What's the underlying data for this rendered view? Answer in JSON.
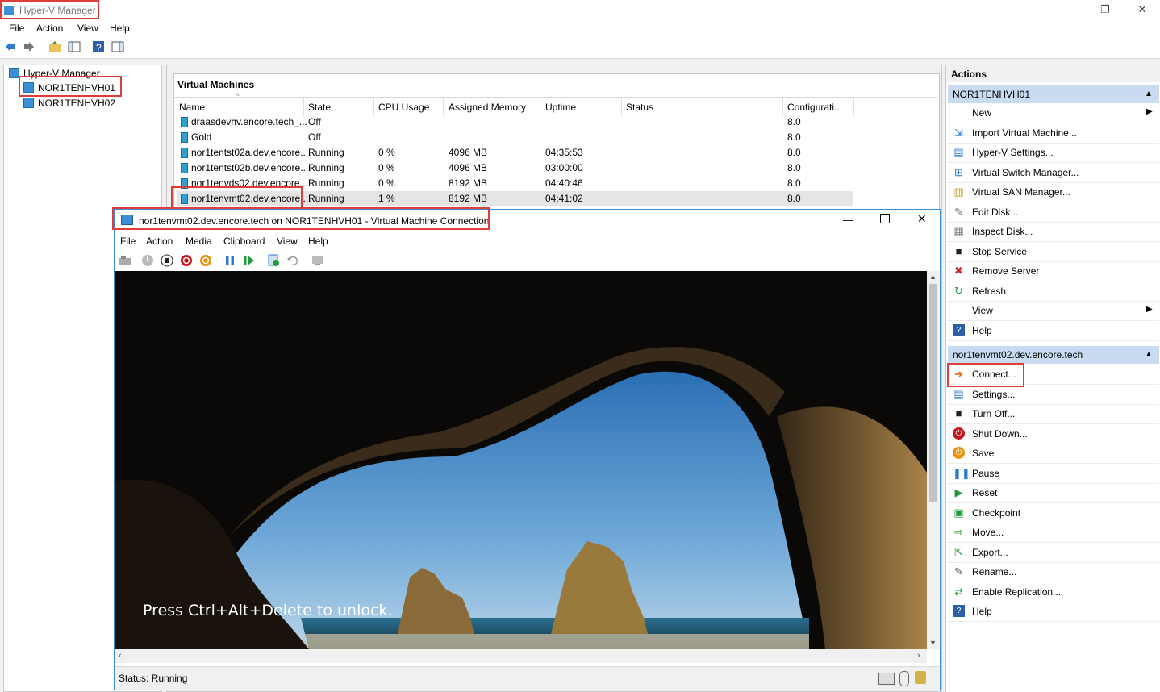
{
  "app_title": "Hyper-V Manager",
  "menu": [
    "File",
    "Action",
    "View",
    "Help"
  ],
  "tree": {
    "root": "Hyper-V Manager",
    "servers": [
      "NOR1TENHVH01",
      "NOR1TENHVH02"
    ]
  },
  "vm_panel": {
    "title": "Virtual Machines",
    "columns": [
      "Name",
      "State",
      "CPU Usage",
      "Assigned Memory",
      "Uptime",
      "Status",
      "Configurati..."
    ],
    "rows": [
      {
        "name": "draasdevhv.encore.tech_...",
        "state": "Off",
        "cpu": "",
        "memory": "",
        "uptime": "",
        "status": "",
        "config": "8.0"
      },
      {
        "name": "Gold",
        "state": "Off",
        "cpu": "",
        "memory": "",
        "uptime": "",
        "status": "",
        "config": "8.0"
      },
      {
        "name": "nor1tentst02a.dev.encore....",
        "state": "Running",
        "cpu": "0 %",
        "memory": "4096 MB",
        "uptime": "04:35:53",
        "status": "",
        "config": "8.0"
      },
      {
        "name": "nor1tentst02b.dev.encore....",
        "state": "Running",
        "cpu": "0 %",
        "memory": "4096 MB",
        "uptime": "03:00:00",
        "status": "",
        "config": "8.0"
      },
      {
        "name": "nor1tenvds02.dev.encore....",
        "state": "Running",
        "cpu": "0 %",
        "memory": "8192 MB",
        "uptime": "04:40:46",
        "status": "",
        "config": "8.0"
      },
      {
        "name": "nor1tenvmt02.dev.encore....",
        "state": "Running",
        "cpu": "1 %",
        "memory": "8192 MB",
        "uptime": "04:41:02",
        "status": "",
        "config": "8.0"
      }
    ]
  },
  "vm_connection": {
    "title": "nor1tenvmt02.dev.encore.tech on NOR1TENHVH01 - Virtual Machine Connection",
    "menu": [
      "File",
      "Action",
      "Media",
      "Clipboard",
      "View",
      "Help"
    ],
    "lock_text": "Press Ctrl+Alt+Delete to unlock.",
    "status": "Status: Running"
  },
  "actions": {
    "header": "Actions",
    "groups": [
      {
        "title": "NOR1TENHVH01",
        "items": [
          {
            "label": "New",
            "icon": "blank-icon",
            "submenu": true
          },
          {
            "label": "Import Virtual Machine...",
            "icon": "import-icon"
          },
          {
            "label": "Hyper-V Settings...",
            "icon": "settings-icon"
          },
          {
            "label": "Virtual Switch Manager...",
            "icon": "switch-icon"
          },
          {
            "label": "Virtual SAN Manager...",
            "icon": "san-icon"
          },
          {
            "label": "Edit Disk...",
            "icon": "edit-disk-icon"
          },
          {
            "label": "Inspect Disk...",
            "icon": "inspect-disk-icon"
          },
          {
            "label": "Stop Service",
            "icon": "stop-icon"
          },
          {
            "label": "Remove Server",
            "icon": "remove-icon"
          },
          {
            "label": "Refresh",
            "icon": "refresh-icon"
          },
          {
            "label": "View",
            "icon": "blank-icon",
            "submenu": true
          },
          {
            "label": "Help",
            "icon": "help-icon"
          }
        ]
      },
      {
        "title": "nor1tenvmt02.dev.encore.tech",
        "items": [
          {
            "label": "Connect...",
            "icon": "connect-icon"
          },
          {
            "label": "Settings...",
            "icon": "settings-icon"
          },
          {
            "label": "Turn Off...",
            "icon": "turn-off-icon"
          },
          {
            "label": "Shut Down...",
            "icon": "shutdown-icon"
          },
          {
            "label": "Save",
            "icon": "save-icon"
          },
          {
            "label": "Pause",
            "icon": "pause-icon"
          },
          {
            "label": "Reset",
            "icon": "reset-icon"
          },
          {
            "label": "Checkpoint",
            "icon": "checkpoint-icon"
          },
          {
            "label": "Move...",
            "icon": "move-icon"
          },
          {
            "label": "Export...",
            "icon": "export-icon"
          },
          {
            "label": "Rename...",
            "icon": "rename-icon"
          },
          {
            "label": "Enable Replication...",
            "icon": "replication-icon"
          },
          {
            "label": "Help",
            "icon": "help-icon"
          }
        ]
      }
    ]
  }
}
